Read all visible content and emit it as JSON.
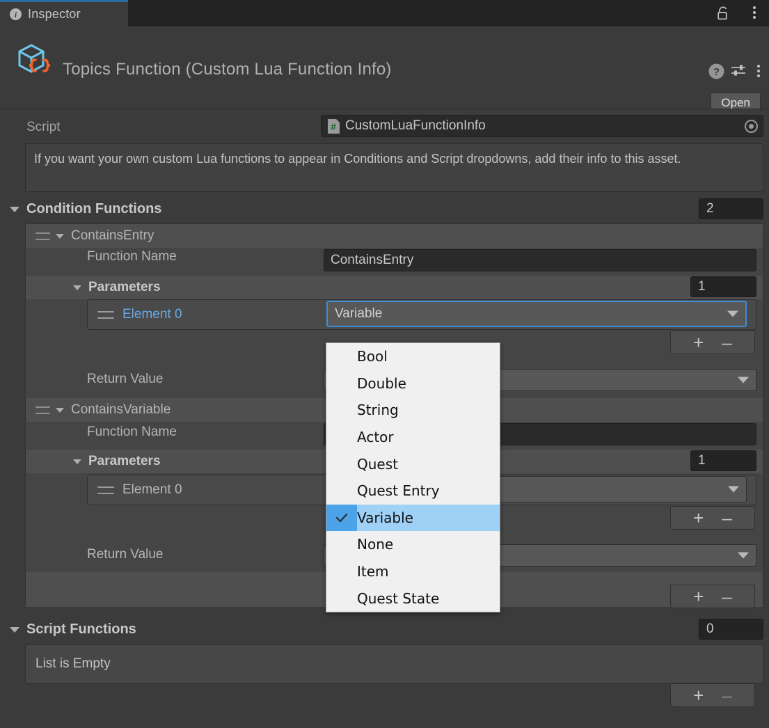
{
  "window": {
    "tab_label": "Inspector",
    "tab_icon": "info-icon",
    "lock_icon": "unlock-icon",
    "menu_icon": "kebab-menu-icon",
    "accent": "#2c6ca3",
    "background": "#3b3b3b"
  },
  "object_header": {
    "icon": "scriptable-object-icon",
    "title": "Topics Function (Custom Lua Function Info)",
    "help_icon": "help-icon",
    "preset_icon": "preset-sliders-icon",
    "menu_icon": "kebab-menu-icon",
    "open_label": "Open"
  },
  "script_row": {
    "label": "Script",
    "value": "CustomLuaFunctionInfo",
    "icon": "cs-script-icon",
    "picker_icon": "object-picker-target-icon"
  },
  "help_box": {
    "text": "If you want your own custom Lua functions to appear in Conditions and Script dropdowns, add their info to this asset."
  },
  "condition_functions": {
    "label": "Condition Functions",
    "size": "2",
    "entries": [
      {
        "name": "ContainsEntry",
        "function_name_label": "Function Name",
        "function_name_value": "ContainsEntry",
        "parameters_label": "Parameters",
        "parameters_size": "1",
        "elements": [
          {
            "label": "Element 0",
            "value": "Variable",
            "selected": true
          }
        ],
        "return_value_label": "Return Value",
        "return_value": "",
        "add_label": "+",
        "remove_label": "–"
      },
      {
        "name": "ContainsVariable",
        "function_name_label": "Function Name",
        "function_name_value": "",
        "parameters_label": "Parameters",
        "parameters_size": "1",
        "elements": [
          {
            "label": "Element 0",
            "value": "",
            "selected": false
          }
        ],
        "return_value_label": "Return Value",
        "return_value": "",
        "add_label": "+",
        "remove_label": "–"
      }
    ],
    "list_add_label": "+",
    "list_remove_label": "–"
  },
  "script_functions": {
    "label": "Script Functions",
    "size": "0",
    "empty_text": "List is Empty",
    "add_label": "+",
    "remove_label": "–"
  },
  "dropdown_popup": {
    "open": true,
    "selected": "Variable",
    "highlight_color": "#9fd0f5",
    "check_color": "#4da3ea",
    "items": [
      "Bool",
      "Double",
      "String",
      "Actor",
      "Quest",
      "Quest Entry",
      "Variable",
      "None",
      "Item",
      "Quest State"
    ]
  }
}
